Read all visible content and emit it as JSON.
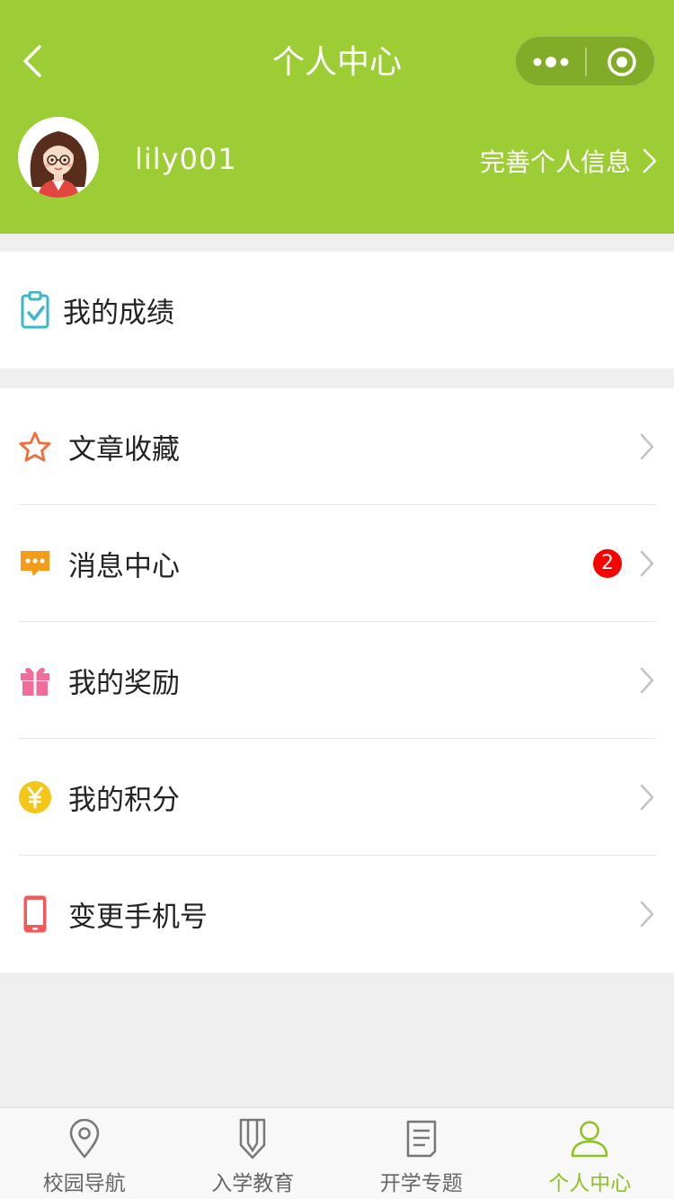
{
  "header": {
    "title": "个人中心",
    "back_icon": "chevron-left-icon",
    "capsule": {
      "more_icon": "more-dots-icon",
      "close_icon": "target-circle-icon"
    },
    "background": "#9ccd34"
  },
  "profile": {
    "username": "lily001",
    "edit_link": "完善个人信息"
  },
  "score_card": {
    "label": "我的成绩",
    "icon": "clipboard-check-icon"
  },
  "menu": [
    {
      "label": "文章收藏",
      "icon": "star-icon",
      "color": "#f26d3d"
    },
    {
      "label": "消息中心",
      "icon": "message-icon",
      "color": "#f59b1a",
      "badge": "2"
    },
    {
      "label": "我的奖励",
      "icon": "gift-icon",
      "color": "#f06c9b"
    },
    {
      "label": "我的积分",
      "icon": "yen-coin-icon",
      "color": "#f5c518"
    },
    {
      "label": "变更手机号",
      "icon": "phone-icon",
      "color": "#f25a5a"
    }
  ],
  "tabbar": {
    "active_color": "#8dc21f",
    "tabs": [
      {
        "label": "校园导航",
        "icon": "location-pin-icon"
      },
      {
        "label": "入学教育",
        "icon": "bookmark-pen-icon"
      },
      {
        "label": "开学专题",
        "icon": "document-icon"
      },
      {
        "label": "个人中心",
        "icon": "user-icon",
        "active": true
      }
    ]
  }
}
